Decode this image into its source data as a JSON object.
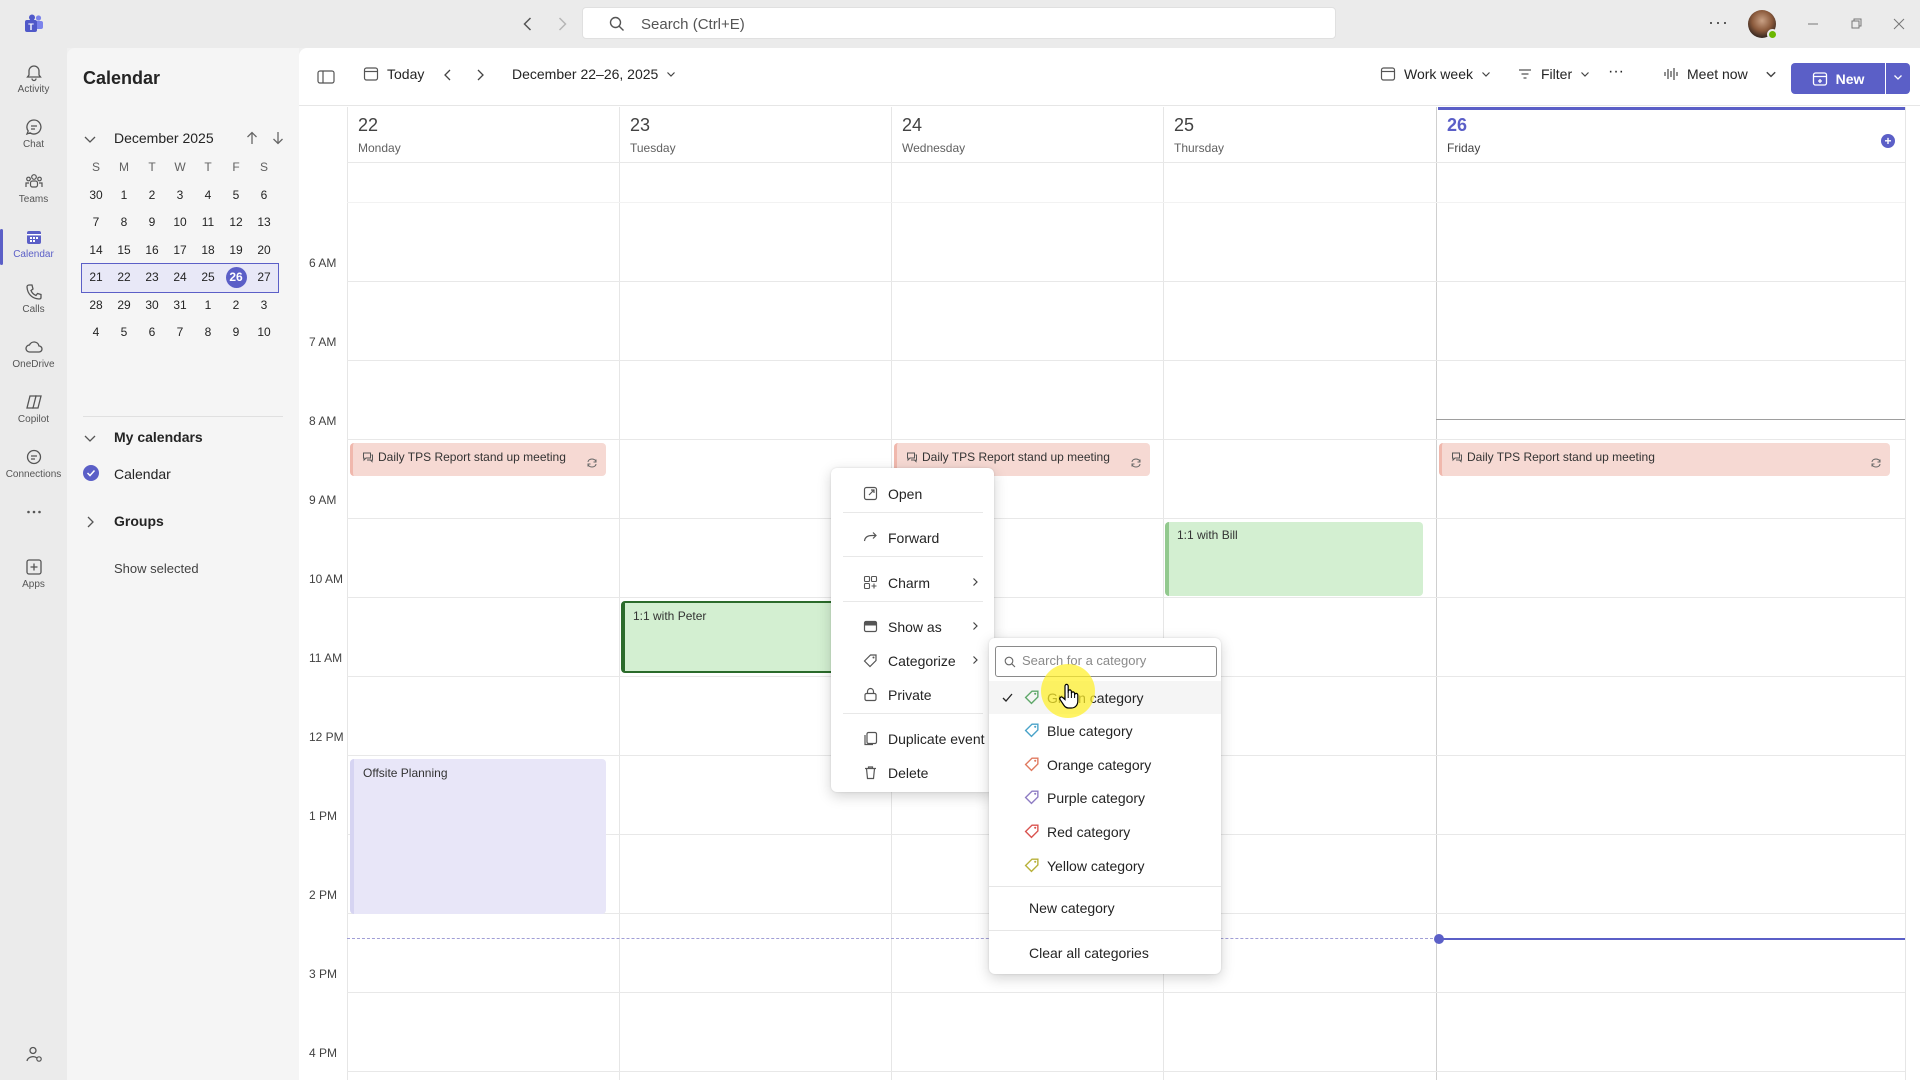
{
  "titlebar": {
    "search_placeholder": "Search (Ctrl+E)",
    "more": "···"
  },
  "rail": [
    {
      "label": "Activity",
      "icon": "bell-icon"
    },
    {
      "label": "Chat",
      "icon": "chat-icon"
    },
    {
      "label": "Teams",
      "icon": "teams-icon"
    },
    {
      "label": "Calendar",
      "icon": "calendar-icon",
      "active": true
    },
    {
      "label": "Calls",
      "icon": "phone-icon"
    },
    {
      "label": "OneDrive",
      "icon": "cloud-icon"
    },
    {
      "label": "Copilot",
      "icon": "copilot-icon"
    },
    {
      "label": "Connections",
      "icon": "connections-icon"
    },
    {
      "label": "",
      "icon": "more-icon"
    },
    {
      "label": "Apps",
      "icon": "apps-icon"
    }
  ],
  "sidepane": {
    "title": "Calendar",
    "month_label": "December 2025",
    "weekdays": [
      "S",
      "M",
      "T",
      "W",
      "T",
      "F",
      "S"
    ],
    "weeks": [
      [
        "30",
        "1",
        "2",
        "3",
        "4",
        "5",
        "6"
      ],
      [
        "7",
        "8",
        "9",
        "10",
        "11",
        "12",
        "13"
      ],
      [
        "14",
        "15",
        "16",
        "17",
        "18",
        "19",
        "20"
      ],
      [
        "21",
        "22",
        "23",
        "24",
        "25",
        "26",
        "27"
      ],
      [
        "28",
        "29",
        "30",
        "31",
        "1",
        "2",
        "3"
      ],
      [
        "4",
        "5",
        "6",
        "7",
        "8",
        "9",
        "10"
      ]
    ],
    "selected_week_index": 3,
    "today": "26",
    "my_calendars": "My calendars",
    "calendar_item": "Calendar",
    "groups": "Groups",
    "show_selected": "Show selected"
  },
  "toolbar": {
    "today": "Today",
    "range": "December 22–26, 2025",
    "view": "Work week",
    "filter": "Filter",
    "more": "···",
    "meet_now": "Meet now",
    "new": "New"
  },
  "days": [
    {
      "num": "22",
      "name": "Monday"
    },
    {
      "num": "23",
      "name": "Tuesday"
    },
    {
      "num": "24",
      "name": "Wednesday"
    },
    {
      "num": "25",
      "name": "Thursday"
    },
    {
      "num": "26",
      "name": "Friday",
      "today": true
    }
  ],
  "times": [
    "6 AM",
    "7 AM",
    "8 AM",
    "9 AM",
    "10 AM",
    "11 AM",
    "12 PM",
    "1 PM",
    "2 PM",
    "3 PM",
    "4 PM"
  ],
  "events": {
    "tps": "Daily TPS Report stand up meeting",
    "peter": "1:1 with Peter",
    "bill": "1:1 with Bill",
    "offsite": "Offsite Planning"
  },
  "context_menu": {
    "open": "Open",
    "forward": "Forward",
    "charm": "Charm",
    "show_as": "Show as",
    "categorize": "Categorize",
    "private": "Private",
    "duplicate": "Duplicate event",
    "delete": "Delete"
  },
  "categories_menu": {
    "search_placeholder": "Search for a category",
    "items": [
      {
        "label": "Green category",
        "color": "#5fa86a",
        "checked": true
      },
      {
        "label": "Blue category",
        "color": "#4aa3c9"
      },
      {
        "label": "Orange category",
        "color": "#e07a5f"
      },
      {
        "label": "Purple category",
        "color": "#8e7cc3"
      },
      {
        "label": "Red category",
        "color": "#d9534f"
      },
      {
        "label": "Yellow category",
        "color": "#b8b13a"
      }
    ],
    "new_category": "New category",
    "clear_all": "Clear all categories"
  },
  "colors": {
    "accent": "#5b5fc7"
  }
}
